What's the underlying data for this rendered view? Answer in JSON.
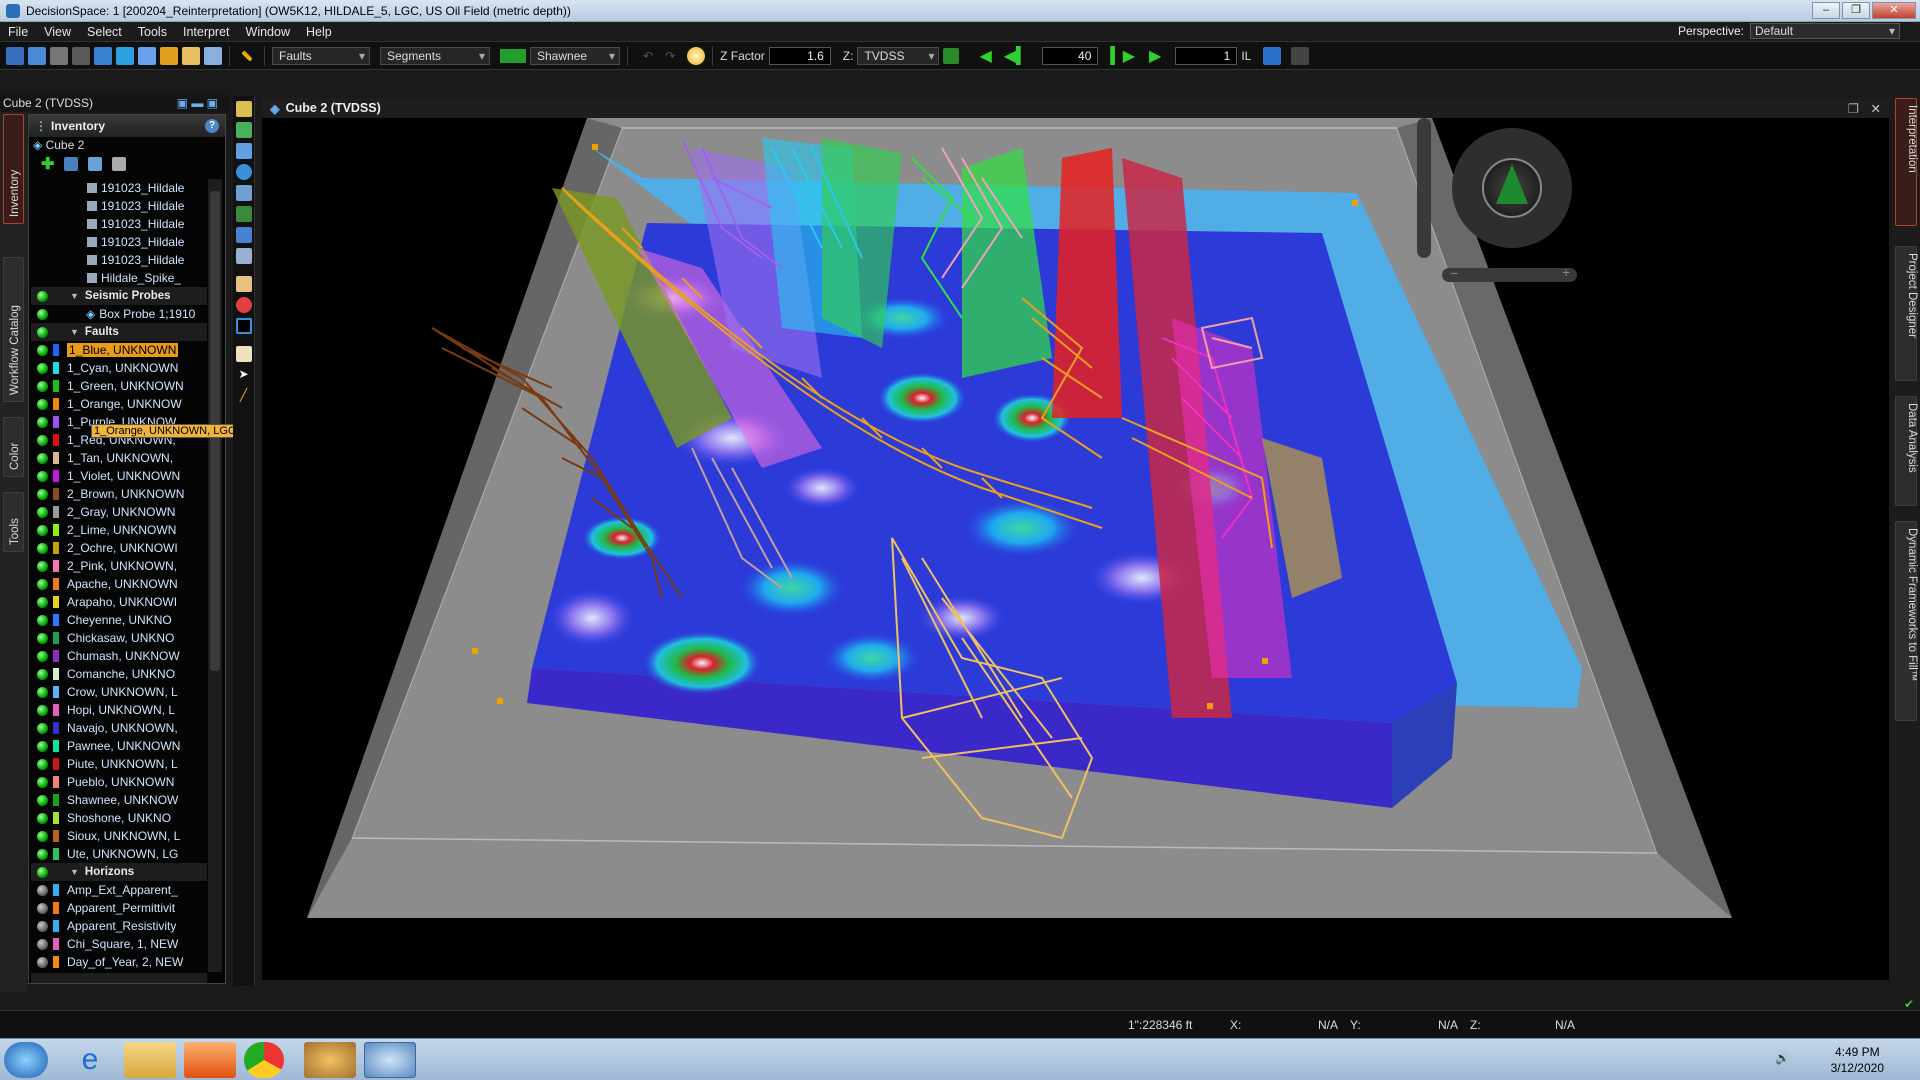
{
  "window": {
    "title": "DecisionSpace: 1 [200204_Reinterpretation] (OW5K12, HILDALE_5, LGC, US Oil Field (metric depth))",
    "controls": [
      "–",
      "❐",
      "✕"
    ]
  },
  "menu": [
    "File",
    "View",
    "Select",
    "Tools",
    "Interpret",
    "Window",
    "Help"
  ],
  "perspective": {
    "label": "Perspective:",
    "value": "Default"
  },
  "toolbar": {
    "type_select": "Faults",
    "mode_select": "Segments",
    "fault_select": "Shawnee",
    "zfactor_label": "Z Factor",
    "zfactor": "1.6",
    "z_domain_label": "Z:",
    "z_domain": "TVDSS",
    "slice_value": "40",
    "step_value": "1",
    "il_label": "IL",
    "accent": "#1f9e2a"
  },
  "left_tabs": [
    "Inventory",
    "Workflow Catalog",
    "Color",
    "Tools"
  ],
  "panel_title": "Cube 2 (TVDSS)",
  "inventory": {
    "title": "Inventory",
    "cube": "Cube 2",
    "items": [
      {
        "type": "sub",
        "label": "191023_Hildale"
      },
      {
        "type": "sub",
        "label": "191023_Hildale"
      },
      {
        "type": "sub",
        "label": "191023_Hildale"
      },
      {
        "type": "sub",
        "label": "191023_Hildale"
      },
      {
        "type": "sub",
        "label": "191023_Hildale"
      },
      {
        "type": "sub",
        "label": "Hildale_Spike_"
      },
      {
        "type": "section",
        "label": "Seismic Probes"
      },
      {
        "type": "probe",
        "label": "Box Probe 1;1910"
      },
      {
        "type": "section",
        "label": "Faults"
      },
      {
        "type": "item",
        "label": "1_Blue, UNKNOWN",
        "color": "#1e62ff",
        "selected": true
      },
      {
        "type": "item",
        "label": "1_Cyan, UNKNOWN",
        "color": "#17d9e8"
      },
      {
        "type": "item",
        "label": "1_Green, UNKNOWN",
        "color": "#18c21c"
      },
      {
        "type": "item",
        "label": "1_Orange, UNKNOW",
        "color": "#f08a10"
      },
      {
        "type": "item",
        "label": "1_Purple, UNKNOW",
        "color": "#a050f0"
      },
      {
        "type": "item",
        "label": "1_Red, UNKNOWN,",
        "color": "#e01010"
      },
      {
        "type": "item",
        "label": "1_Tan, UNKNOWN,",
        "color": "#d8b58a"
      },
      {
        "type": "item",
        "label": "1_Violet, UNKNOWN",
        "color": "#c018e0"
      },
      {
        "type": "item",
        "label": "2_Brown, UNKNOWN",
        "color": "#8a4a1a"
      },
      {
        "type": "item",
        "label": "2_Gray, UNKNOWN",
        "color": "#9a9a9a"
      },
      {
        "type": "item",
        "label": "2_Lime, UNKNOWN",
        "color": "#8aee10"
      },
      {
        "type": "item",
        "label": "2_Ochre, UNKNOWI",
        "color": "#c8a010"
      },
      {
        "type": "item",
        "label": "2_Pink, UNKNOWN,",
        "color": "#f078b8"
      },
      {
        "type": "item",
        "label": "Apache, UNKNOWN",
        "color": "#f07a18"
      },
      {
        "type": "item",
        "label": "Arapaho, UNKNOWI",
        "color": "#e8d020"
      },
      {
        "type": "item",
        "label": "Cheyenne, UNKNO",
        "color": "#2a7aff"
      },
      {
        "type": "item",
        "label": "Chickasaw, UNKNO",
        "color": "#1aa050"
      },
      {
        "type": "item",
        "label": "Chumash, UNKNOW",
        "color": "#8a30c0"
      },
      {
        "type": "item",
        "label": "Comanche, UNKNO",
        "color": "#d8ead0"
      },
      {
        "type": "item",
        "label": "Crow, UNKNOWN, L",
        "color": "#5ab0ff"
      },
      {
        "type": "item",
        "label": "Hopi, UNKNOWN, L",
        "color": "#e060c0"
      },
      {
        "type": "item",
        "label": "Navajo, UNKNOWN,",
        "color": "#3030d0"
      },
      {
        "type": "item",
        "label": "Pawnee, UNKNOWN",
        "color": "#10e0a0"
      },
      {
        "type": "item",
        "label": "Piute, UNKNOWN, L",
        "color": "#c81818"
      },
      {
        "type": "item",
        "label": "Pueblo, UNKNOWN",
        "color": "#f08080"
      },
      {
        "type": "item",
        "label": "Shawnee, UNKNOW",
        "color": "#18a018"
      },
      {
        "type": "item",
        "label": "Shoshone, UNKNO",
        "color": "#a8e030"
      },
      {
        "type": "item",
        "label": "Sioux, UNKNOWN, L",
        "color": "#c06020"
      },
      {
        "type": "item",
        "label": "Ute, UNKNOWN, LG",
        "color": "#30c060"
      },
      {
        "type": "section",
        "label": "Horizons"
      },
      {
        "type": "hitem",
        "label": "Amp_Ext_Apparent_",
        "color": "#30b0f0",
        "ring": true
      },
      {
        "type": "hitem",
        "label": "Apparent_Permittivit",
        "color": "#f07a18"
      },
      {
        "type": "hitem",
        "label": "Apparent_Resistivity",
        "color": "#30b0f0"
      },
      {
        "type": "hitem",
        "label": "Chi_Square, 1, NEW",
        "color": "#e060c0"
      },
      {
        "type": "hitem",
        "label": "Day_of_Year, 2, NEW",
        "color": "#f08a10"
      }
    ],
    "tooltip": "1_Orange, UNKNOWN, LGC"
  },
  "viewer": {
    "title": "Cube 2 (TVDSS)"
  },
  "right_tabs": [
    "Interpretation",
    "Project Designer",
    "Data Analysis",
    "Dynamic Frameworks to Fill™"
  ],
  "status": {
    "scale": "1\":228346 ft",
    "x_label": "X:",
    "x": "N/A",
    "y_label": "Y:",
    "y": "N/A",
    "z_label": "Z:",
    "z": "N/A"
  },
  "taskbar": {
    "time": "4:49 PM",
    "date": "3/12/2020"
  }
}
